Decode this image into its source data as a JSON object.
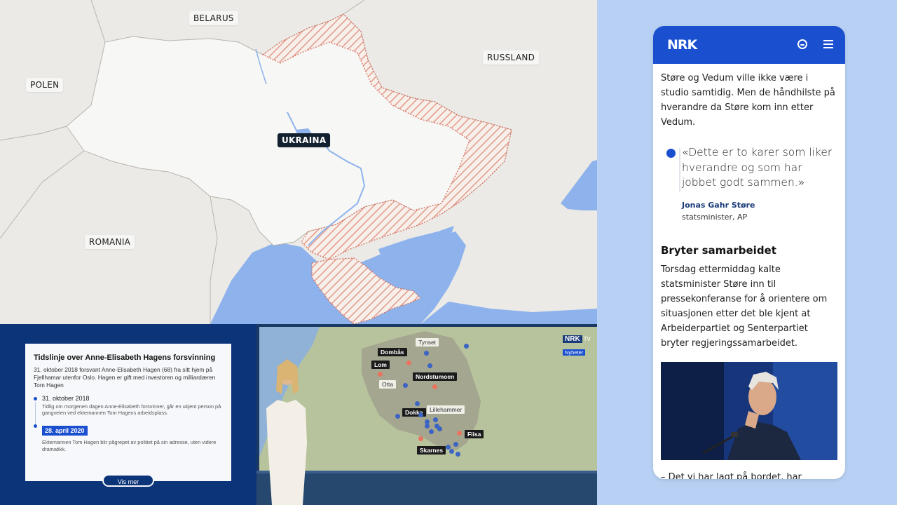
{
  "map": {
    "labels": {
      "belarus": "BELARUS",
      "russia": "RUSSLAND",
      "poland": "POLEN",
      "ukraine": "UKRAINA",
      "romania": "ROMANIA"
    },
    "colors": {
      "land": "#eceae6",
      "ukraine": "#f7f7f5",
      "sea": "#8eb3ec",
      "occupied_hatch": "#e39a8c"
    }
  },
  "timeline": {
    "title": "Tidslinje over Anne-Elisabeth Hagens forsvinning",
    "intro": "31. oktober 2018 forsvant Anne-Elisabeth Hagen (68) fra sitt hjem på Fjellhamar utenfor Oslo. Hagen er gift med investoren og milliardæren Tom Hagen",
    "entries": [
      {
        "date": "31. oktober 2018",
        "text": "Tidlig om morgenen dagen Anne-Elisabeth forsvinner, går en ukjent person på gangveien ved ektemannen Tom Hagens arbeidsplass."
      },
      {
        "date": "28. april 2020",
        "text": "Ektemannen Tom Hagen blir pågrepet av politiet på sin adresse, uten videre dramatikk."
      }
    ],
    "more_button": "Vis mer"
  },
  "tv": {
    "logo": "NRK",
    "logo_tv": "TV",
    "logo_sub": "Nyheter",
    "places": {
      "dombas": "Dombås",
      "tynset": "Tynset",
      "lom": "Lom",
      "nordstumoen": "Nordstumoen",
      "otta": "Otta",
      "dokka": "Dokka",
      "lillehammer": "Lillehammer",
      "flisa": "Flisa",
      "skarnes": "Skarnes"
    }
  },
  "article": {
    "logo": "NRK",
    "intro": "Støre og Vedum ville ikke være i studio samtidig. Men de håndhilste på hverandre da Støre kom inn etter Vedum.",
    "quote": "«Dette er to karer som liker hverandre og som har jobbet godt sammen.»",
    "quote_name": "Jonas Gahr Støre",
    "quote_role": "statsminister, AP",
    "subheading": "Bryter samarbeidet",
    "body": "Torsdag ettermiddag kalte statsminister Støre inn til pressekonferanse for å orientere om situasjonen etter det ble kjent at Arbeiderpartiet og Senterpartiet bryter regjeringssamarbeidet.",
    "body2": "– Det vi har lagt på bordet, har dessverre ikke vært nok til at Senterpartiet valgte å"
  }
}
